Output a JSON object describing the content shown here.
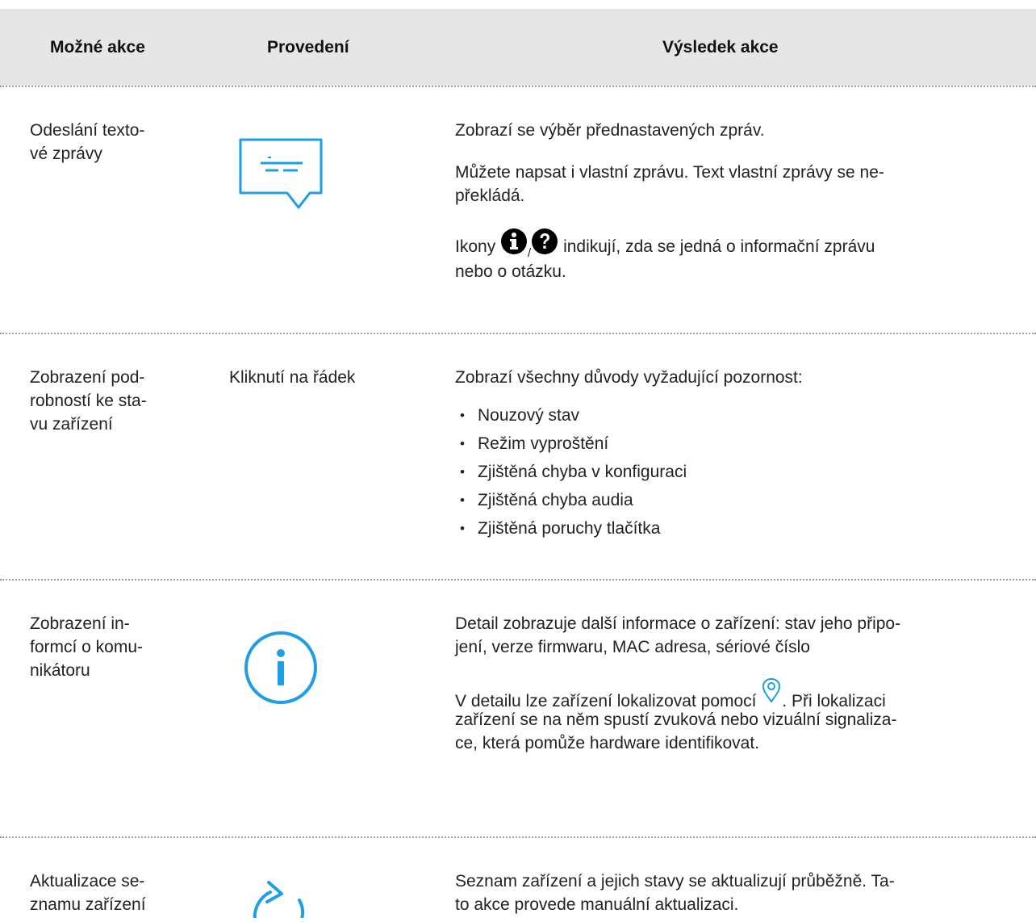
{
  "header": {
    "col_actions": "Možné akce",
    "col_execution": "Provedení",
    "col_result": "Výsledek akce"
  },
  "rows": [
    {
      "action_line1": "Odeslání texto-",
      "action_line2": "vé zprávy",
      "execution_icon": "message-bubble-icon",
      "result_p1": "Zobrazí se výběr přednastavených zpráv.",
      "result_p2_line1": "Můžete napsat i vlastní zprávu. Text vlastní zprávy se ne-",
      "result_p2_line2": "překládá.",
      "result_p3_prefix": "Ikony",
      "result_p3_sep": "/",
      "result_p3_suffix": "indikují, zda se jedná o informační zprávu",
      "result_p3_line2": "nebo o otázku."
    },
    {
      "action_line1": "Zobrazení pod-",
      "action_line2": "robností ke sta-",
      "action_line3": "vu zařízení",
      "execution_text": "Kliknutí na řádek",
      "result_intro": "Zobrazí všechny důvody vyžadující pozornost:",
      "bullets": [
        "Nouzový stav",
        "Režim vyproštění",
        "Zjištěná chyba v konfiguraci",
        "Zjištěná chyba audia",
        "Zjištěná poruchy tlačítka"
      ]
    },
    {
      "action_line1": "Zobrazení in-",
      "action_line2": "formcí o komu-",
      "action_line3": "nikátoru",
      "execution_icon": "info-circle-icon",
      "result_p1_line1": "Detail zobrazuje další informace o zařízení: stav jeho připo-",
      "result_p1_line2": "jení, verze firmwaru, MAC adresa, sériové číslo",
      "result_p2_prefix": "V detailu lze zařízení lokalizovat pomocí",
      "result_p2_suffix": ". Při lokalizaci",
      "result_p2_line2": "zařízení se na něm spustí zvuková nebo vizuální signaliza-",
      "result_p2_line3": "ce, která pomůže hardware identifikovat."
    },
    {
      "action_line1": "Aktualizace se-",
      "action_line2": "znamu zařízení",
      "execution_icon": "refresh-icon",
      "result_line1": "Seznam zařízení a jejich stavy se aktualizují průběžně. Ta-",
      "result_line2": "to akce provede manuální aktualizaci."
    }
  ],
  "colors": {
    "accent": "#1e9ee6",
    "header_bg": "#e6e6e6",
    "divider": "#9a9a9a"
  }
}
